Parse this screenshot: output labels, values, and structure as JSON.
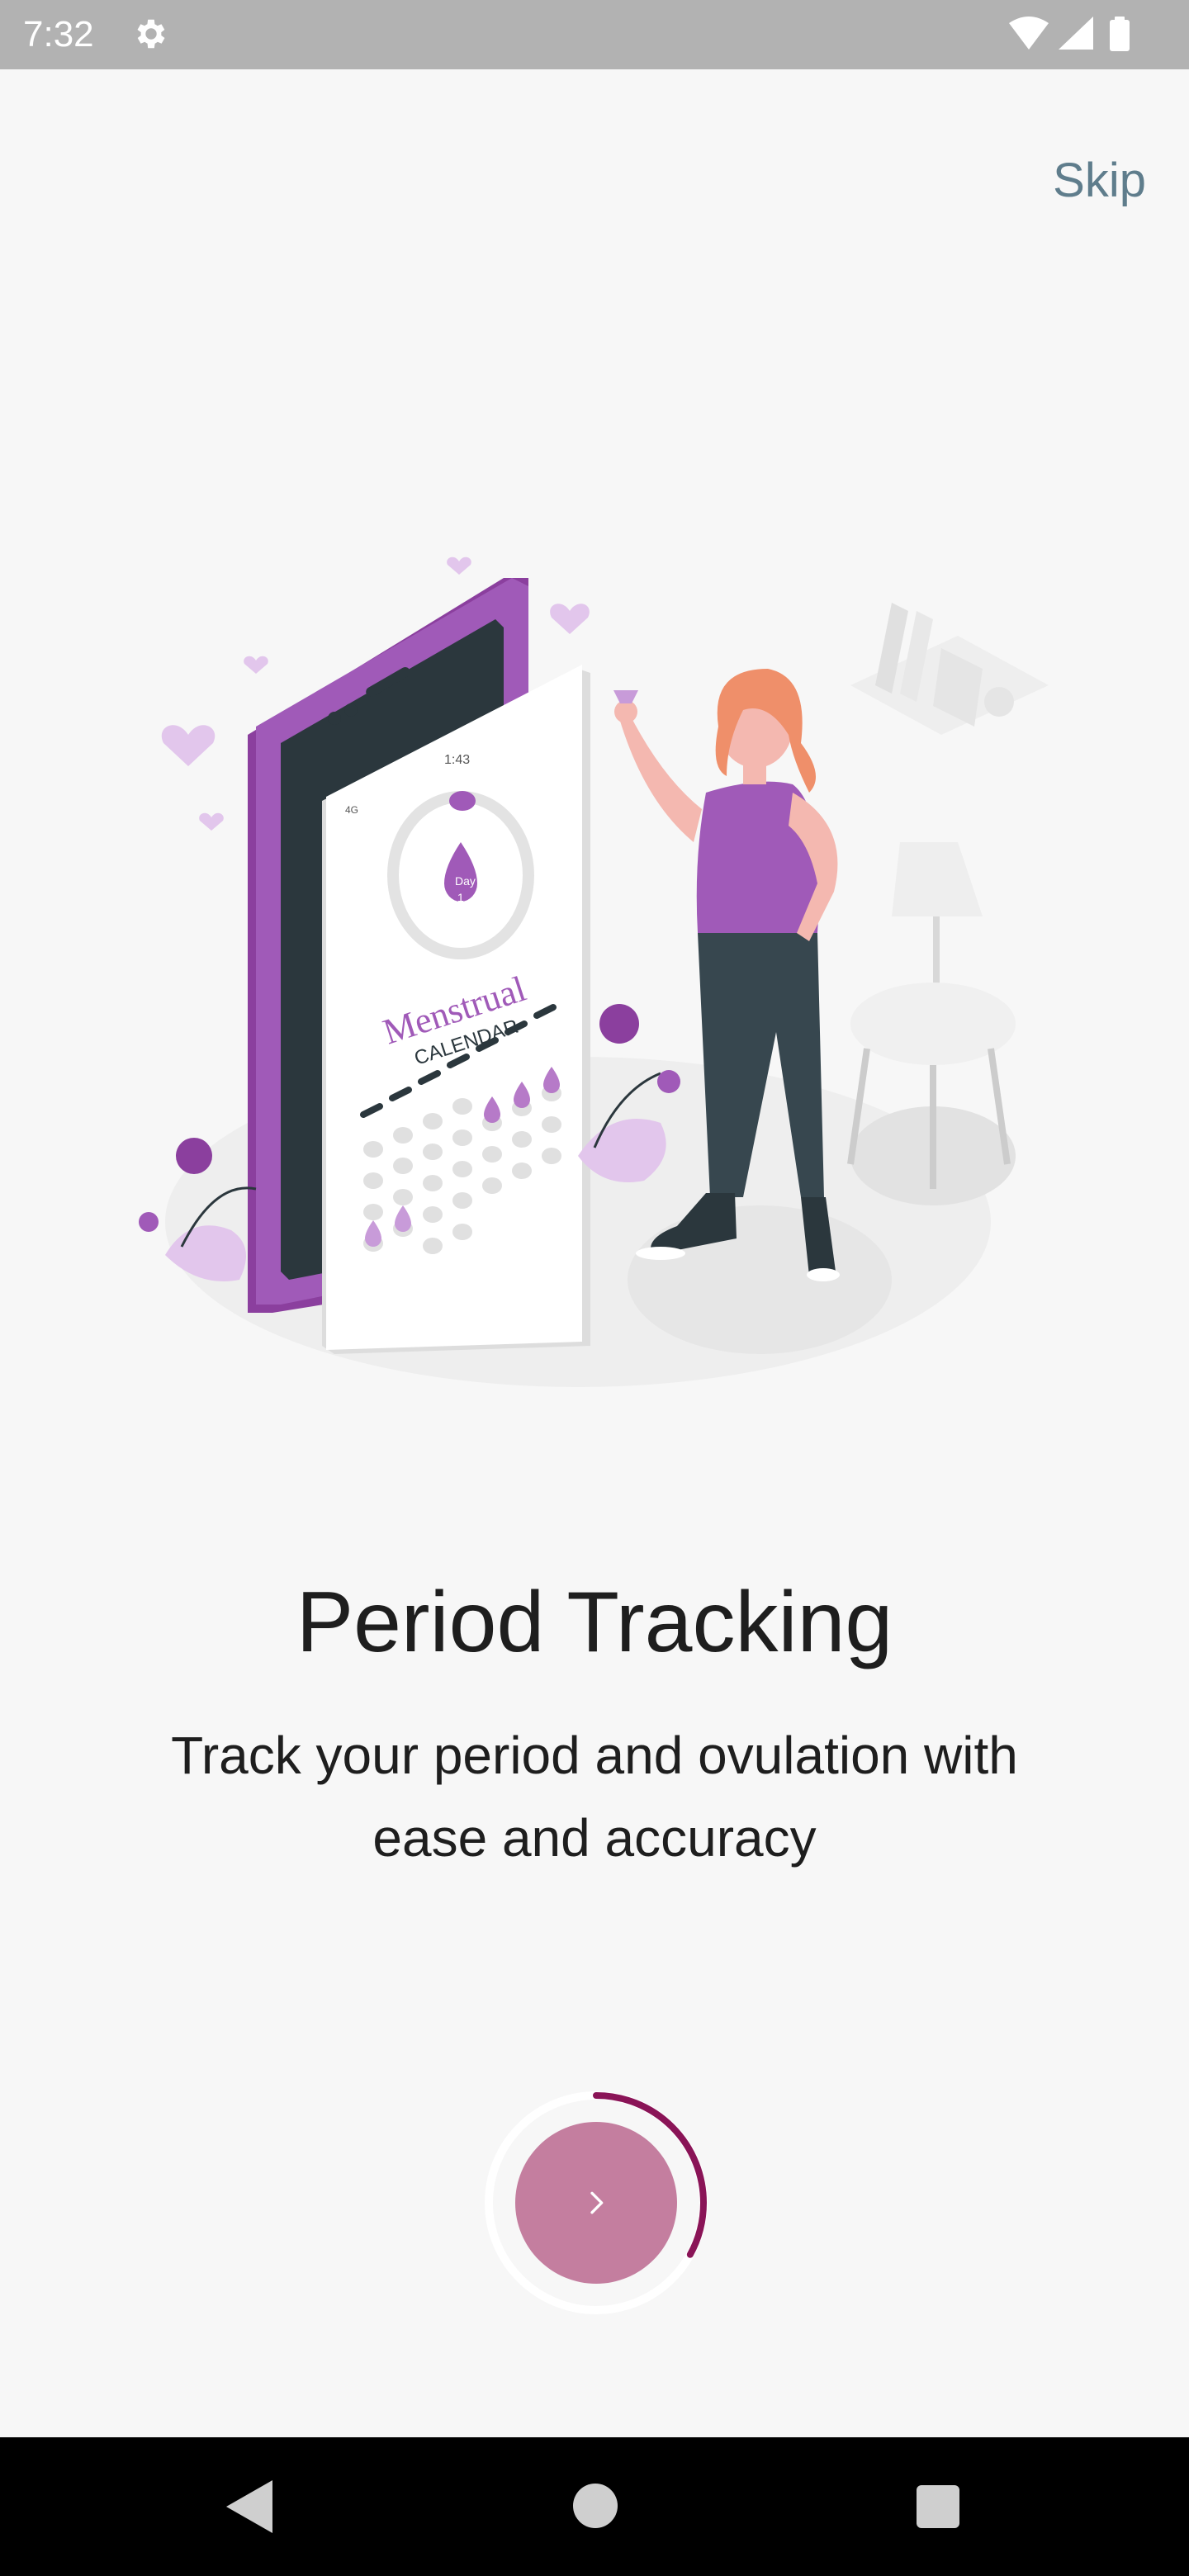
{
  "status_bar": {
    "time": "7:32",
    "icons": [
      "settings-gear-icon",
      "wifi-icon",
      "cell-signal-icon",
      "battery-icon"
    ]
  },
  "onboarding": {
    "skip_label": "Skip",
    "title": "Period Tracking",
    "description_line1": "Track your period and ovulation with",
    "description_line2": "ease and accuracy",
    "illustration": {
      "phone_time": "1:43",
      "phone_network": "4G",
      "calendar_brand": "Menstrual",
      "calendar_subtitle": "CALENDAR",
      "day_badge_label": "Day",
      "day_badge_number": "1"
    },
    "next_button_icon": "chevron-right-icon",
    "progress_fraction": 0.33
  },
  "colors": {
    "accent": "#c47e9f",
    "progress_ring": "#8a1457",
    "skip_text": "#5f7d8c",
    "status_bar_bg": "#b2b2b2",
    "nav_bar_bg": "#000000",
    "purple": "#a05ab8",
    "light_purple": "#c89bd9"
  },
  "nav_bar": {
    "icons": [
      "back-icon",
      "home-icon",
      "recents-icon"
    ]
  }
}
